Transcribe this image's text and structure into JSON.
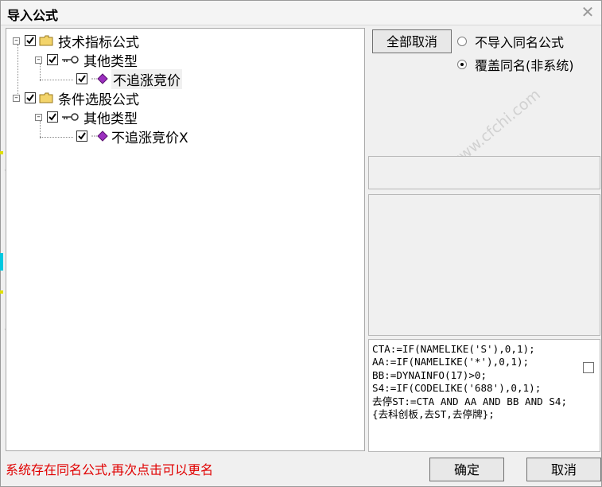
{
  "window": {
    "title": "导入公式"
  },
  "tree": {
    "nodes": [
      {
        "label": "技术指标公式"
      },
      {
        "label": "其他类型"
      },
      {
        "label": "不追涨竞价"
      },
      {
        "label": "条件选股公式"
      },
      {
        "label": "其他类型"
      },
      {
        "label": "不追涨竞价X"
      }
    ]
  },
  "options": {
    "select_all_label": "全部取消",
    "radio_no_import": "不导入同名公式",
    "radio_overwrite": "覆盖同名(非系统)"
  },
  "code": {
    "text": "CTA:=IF(NAMELIKE('S'),0,1);\nAA:=IF(NAMELIKE('*'),0,1);\nBB:=DYNAINFO(17)>0;\nS4:=IF(CODELIKE('688'),0,1);\n去停ST:=CTA AND AA AND BB AND S4;{去科创板,去ST,去停牌};"
  },
  "footer": {
    "status": "系统存在同名公式,再次点击可以更名",
    "ok_label": "确定",
    "cancel_label": "取消"
  },
  "watermark": "www.cfchi.com",
  "colors": {
    "status_red": "#E00000",
    "gem_purple": "#9B2FBF",
    "folder_yellow": "#F3D46B"
  }
}
